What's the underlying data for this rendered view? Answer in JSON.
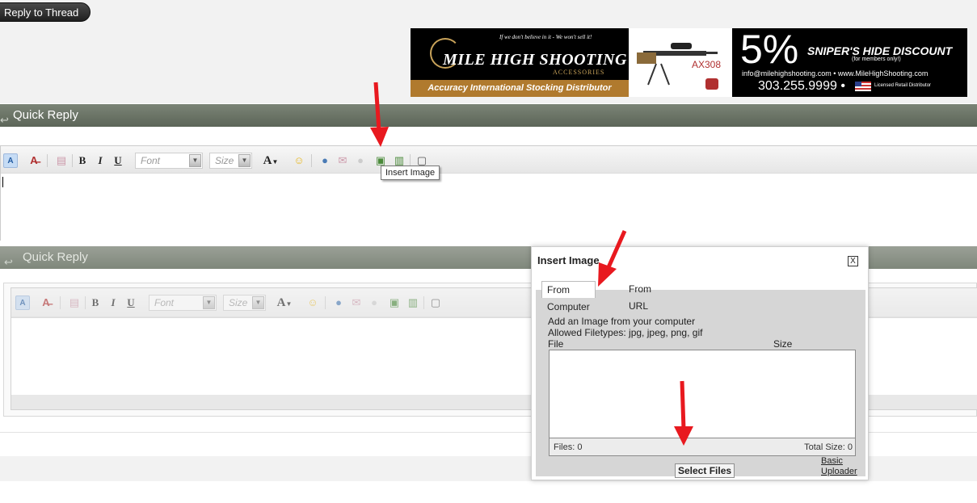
{
  "reply_button": {
    "label": "Reply to Thread"
  },
  "banner": {
    "tagline": "If we don't believe in it - We won't sell it!",
    "brand": "MILE HIGH SHOOTING",
    "brand_sub": "ACCESSORIES",
    "distributor": "Accuracy International Stocking Distributor",
    "gun_model": "AX308",
    "percent": "5%",
    "discount_title": "SNIPER'S HIDE DISCOUNT",
    "discount_note": "(for members only!)",
    "contact": "info@milehighshooting.com • www.MileHighShooting.com",
    "phone": "303.255.9999 •",
    "license": "Licensed Retail Distributor"
  },
  "quick_reply_1": {
    "title": "Quick Reply",
    "toolbar": {
      "font_placeholder": "Font",
      "size_placeholder": "Size",
      "bold": "B",
      "italic": "I",
      "underline": "U",
      "text_color": "A",
      "switch_mode": "A"
    },
    "tooltip": "Insert Image"
  },
  "quick_reply_2": {
    "title": "Quick Reply",
    "toolbar": {
      "font_placeholder": "Font",
      "size_placeholder": "Size",
      "bold": "B",
      "italic": "I",
      "underline": "U",
      "text_color": "A",
      "switch_mode": "A"
    }
  },
  "insert_image_dialog": {
    "title": "Insert Image",
    "close": "X",
    "tabs": [
      "From Computer",
      "From URL"
    ],
    "intro": "Add an Image from your computer",
    "allowed": "Allowed Filetypes: jpg, jpeg, png, gif",
    "col_file": "File",
    "col_size": "Size",
    "files_count": "Files: 0",
    "total_size": "Total Size: 0",
    "select_files": "Select Files",
    "basic_uploader_1": "Basic",
    "basic_uploader_2": "Uploader"
  },
  "colors": {
    "header_green": "#5c6558",
    "arrow_red": "#e8191f",
    "banner_gold": "#b07a2e"
  }
}
